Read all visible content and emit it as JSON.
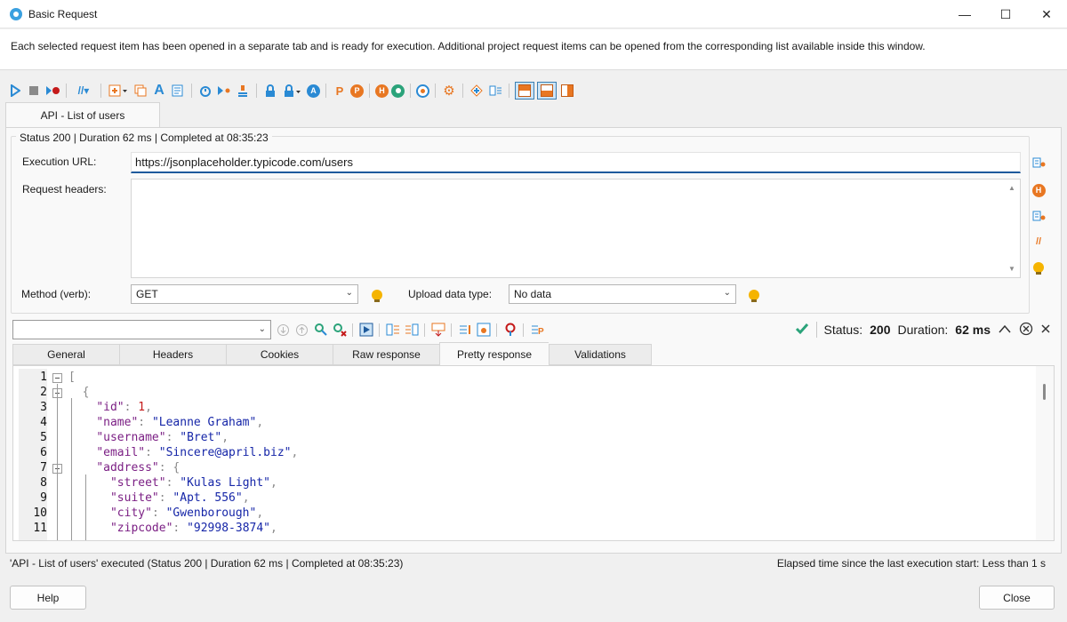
{
  "window": {
    "title": "Basic Request",
    "controls": [
      "—",
      "☐",
      "✕"
    ]
  },
  "info_message": "Each selected request item has been opened in a separate tab and is ready for execution. Additional project request items can be opened from the corresponding list available inside this window.",
  "colors": {
    "accent": "#1e5a9c",
    "orange": "#e87722",
    "blue": "#2a8ad4",
    "green": "#2ba37a"
  },
  "tab": {
    "label": "API - List of users"
  },
  "status_caption": "Status 200 | Duration 62 ms | Completed at 08:35:23",
  "request": {
    "url_label": "Execution URL:",
    "url_value": "https://jsonplaceholder.typicode.com/users",
    "headers_label": "Request headers:",
    "method_label": "Method (verb):",
    "method_value": "GET",
    "upload_label": "Upload data type:",
    "upload_value": "No data"
  },
  "response_status": {
    "status_label": "Status:",
    "status_value": "200",
    "duration_label": "Duration:",
    "duration_value": "62 ms"
  },
  "response_tabs": [
    "General",
    "Headers",
    "Cookies",
    "Raw response",
    "Pretty response",
    "Validations"
  ],
  "active_response_tab": "Pretty response",
  "code_lines": [
    {
      "num": "1",
      "text": "["
    },
    {
      "num": "2",
      "text": "  {"
    },
    {
      "num": "3",
      "text": "    \"id\": 1,"
    },
    {
      "num": "4",
      "text": "    \"name\": \"Leanne Graham\","
    },
    {
      "num": "5",
      "text": "    \"username\": \"Bret\","
    },
    {
      "num": "6",
      "text": "    \"email\": \"Sincere@april.biz\","
    },
    {
      "num": "7",
      "text": "    \"address\": {"
    },
    {
      "num": "8",
      "text": "      \"street\": \"Kulas Light\","
    },
    {
      "num": "9",
      "text": "      \"suite\": \"Apt. 556\","
    },
    {
      "num": "10",
      "text": "      \"city\": \"Gwenborough\","
    },
    {
      "num": "11",
      "text": "      \"zipcode\": \"92998-3874\","
    }
  ],
  "statusbar": {
    "left": "'API - List of users' executed (Status 200 | Duration 62 ms | Completed at 08:35:23)",
    "right": "Elapsed time since the last execution start: Less than 1 s"
  },
  "buttons": {
    "help": "Help",
    "close": "Close"
  }
}
